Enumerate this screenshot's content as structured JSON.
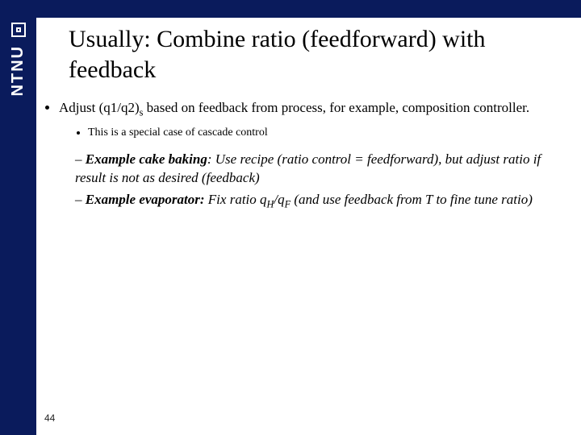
{
  "brand": {
    "logo_text": "NTNU"
  },
  "slide": {
    "title": "Usually: Combine ratio (feedforward) with feedback",
    "page_number": "44",
    "bullet1_pre": "Adjust (q1/q2)",
    "bullet1_sub": "s",
    "bullet1_post": " based on feedback from process, for example, composition controller.",
    "sub_bullet": "This is a special case of cascade control",
    "ex1_lead": "Example cake baking",
    "ex1_rest": ": Use recipe (ratio control = feedforward), but adjust ratio if result is not as desired (feedback)",
    "ex2_lead": "Example evaporator:",
    "ex2_pre": "  Fix ratio q",
    "ex2_qH": "H",
    "ex2_mid": "/q",
    "ex2_qF": "F",
    "ex2_post": " (and use feedback from T to fine tune ratio)"
  }
}
